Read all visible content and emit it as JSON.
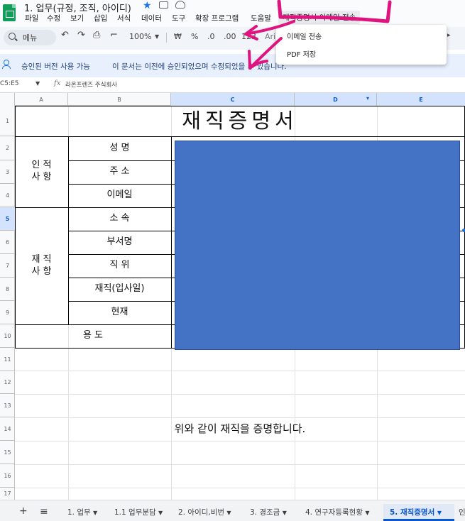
{
  "app": {
    "doc_title": "1. 업무(규정, 조직, 아이디)",
    "menus": [
      "파일",
      "수정",
      "보기",
      "삽입",
      "서식",
      "데이터",
      "도구",
      "확장 프로그램",
      "도움말"
    ],
    "extension_menu": "재직증명서 이메일 전송"
  },
  "toolbar": {
    "search_placeholder": "메뉴",
    "zoom": "100%",
    "currency": "₩",
    "percent": "%",
    "dec_decrease": ".0",
    "dec_increase": ".00",
    "number_format": "123",
    "font": "Aria"
  },
  "dropdown": {
    "items": [
      "이메일 전송",
      "PDF 저장"
    ]
  },
  "banner": {
    "title": "승인된 버전 사용 가능",
    "desc": "이 문서는 이전에 승인되었으며 수정되었을 수 있습니다."
  },
  "formula_bar": {
    "cell_ref": "C5:E5",
    "value": "라온프렌즈 주식회사"
  },
  "grid": {
    "columns": [
      "A",
      "B",
      "C",
      "D",
      "E"
    ],
    "rows": [
      "1",
      "2",
      "3",
      "4",
      "5",
      "6",
      "7",
      "8",
      "9",
      "10",
      "11",
      "12",
      "13",
      "14",
      "15",
      "16",
      "17"
    ],
    "heading": "재직증명서",
    "group1": "인 적\n사 항",
    "group2": "재 직\n사 항",
    "labels": [
      "성 명",
      "주 소",
      "이메일",
      "소 속",
      "부서명",
      "직 위",
      "재직(입사일)",
      "현재"
    ],
    "purpose": "용 도",
    "certify": "위와 같이 재직을 증명합니다."
  },
  "sheet_tabs": {
    "tabs": [
      "1. 업무",
      "1.1 업무분담",
      "2. 아이디,비번",
      "3. 경조금",
      "4. 연구자등록현황",
      "5. 재직증명서",
      "인"
    ],
    "active_index": 5
  },
  "colors": {
    "accent": "#1a73e8",
    "redacted_box": "#4472c4",
    "annotation": "#e0147f"
  }
}
